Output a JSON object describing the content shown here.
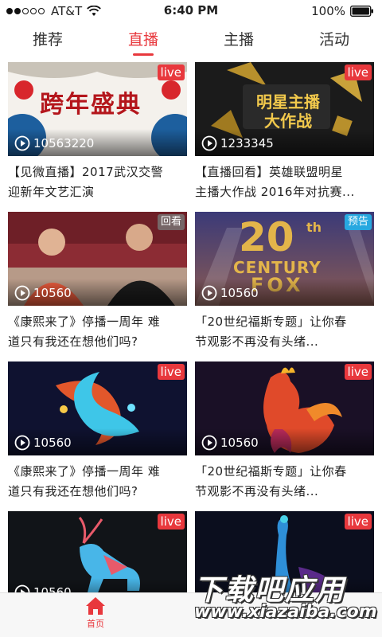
{
  "status_bar": {
    "carrier": "AT&T",
    "time": "6:40 PM",
    "battery": "100%"
  },
  "tabs": [
    {
      "label": "推荐"
    },
    {
      "label": "直播"
    },
    {
      "label": "主播"
    },
    {
      "label": "活动"
    }
  ],
  "active_tab": "直播",
  "cards": [
    {
      "banner_text": "跨年盛典",
      "badge": "live",
      "views": "10563220",
      "caption_l1": "【见微直播】2017武汉交警",
      "caption_l2": "迎新年文艺汇演"
    },
    {
      "banner_text": "明星主播大作战",
      "badge": "live",
      "views": "1233345",
      "caption_l1": "【直播回看】英雄联盟明星",
      "caption_l2": "主播大作战 2016年对抗赛..."
    },
    {
      "badge": "回看",
      "views": "10560",
      "caption_l1": "《康熙来了》停播一周年 难",
      "caption_l2": "道只有我还在想他们吗?"
    },
    {
      "banner_text_1": "20",
      "banner_text_2": "th",
      "banner_text_3": "CENTURY",
      "banner_text_4": "FOX",
      "badge": "预告",
      "views": "10560",
      "caption_l1": "「20世纪福斯专题」让你春",
      "caption_l2": "节观影不再没有头绪..."
    },
    {
      "badge": "live",
      "views": "10560",
      "caption_l1": "《康熙来了》停播一周年 难",
      "caption_l2": "道只有我还在想他们吗?"
    },
    {
      "badge": "live",
      "views": "10560",
      "caption_l1": "「20世纪福斯专题」让你春",
      "caption_l2": "节观影不再没有头绪..."
    },
    {
      "badge": "live",
      "views": "10560"
    },
    {
      "badge": "live"
    }
  ],
  "bottom_nav": {
    "home_label": "首页"
  },
  "watermark": {
    "cn": "下载吧应用",
    "en": "www.xiazaiba.com"
  },
  "colors": {
    "accent": "#e8383d",
    "preview_badge": "#27a8e0"
  },
  "icons": [
    "wifi-icon",
    "battery-icon",
    "play-icon",
    "home-icon"
  ]
}
